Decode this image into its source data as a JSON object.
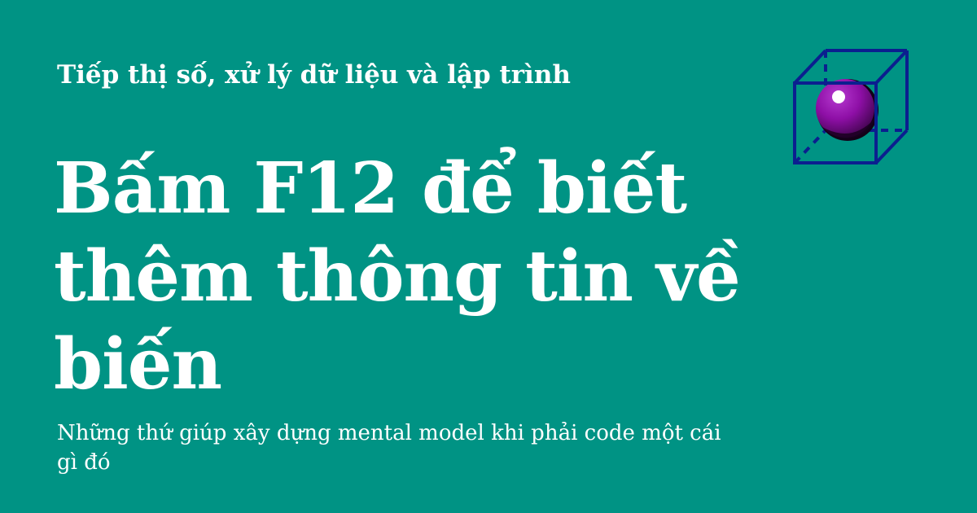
{
  "colors": {
    "background": "#009384",
    "text": "#ffffff",
    "cube_stroke": "#0b1f8f",
    "sphere": "#8e0fa6"
  },
  "kicker": "Tiếp thị số, xử lý dữ liệu và lập trình",
  "title_lines": [
    "Bấm F12 để biết",
    "thêm thông tin về",
    "biến"
  ],
  "subtitle_lines": [
    "Những thứ giúp xây dựng mental model khi phải code một cái",
    "gì đó"
  ],
  "logo": {
    "icon": "cube-with-sphere-icon"
  }
}
